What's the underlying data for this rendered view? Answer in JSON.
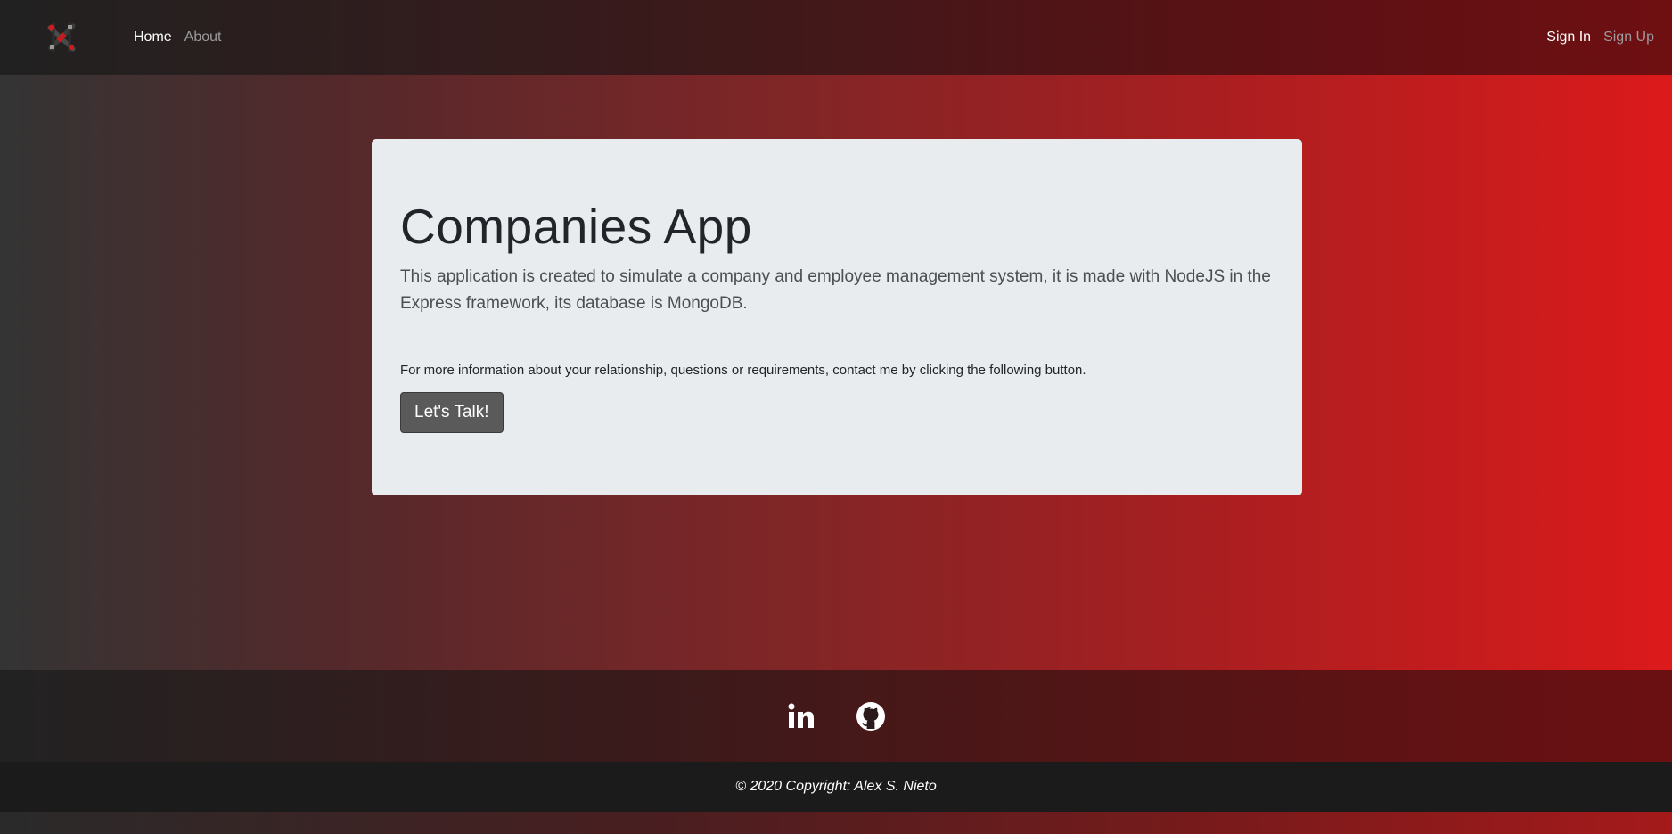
{
  "navbar": {
    "logo_icon": "tools-logo-icon",
    "links": [
      {
        "label": "Home",
        "active": true
      },
      {
        "label": "About",
        "active": false
      }
    ],
    "auth": [
      {
        "label": "Sign In",
        "active": true
      },
      {
        "label": "Sign Up",
        "active": false
      }
    ]
  },
  "jumbotron": {
    "title": "Companies App",
    "lead": "This application is created to simulate a company and employee management system, it is made with NodeJS in the Express framework, its database is MongoDB.",
    "text": "For more information about your relationship, questions or requirements, contact me by clicking the following button.",
    "button_label": "Let's Talk!"
  },
  "footer": {
    "icons": [
      "linkedin-icon",
      "github-icon"
    ],
    "copyright": "© 2020 Copyright: Alex S. Nieto"
  },
  "colors": {
    "gradient_start": "#343434",
    "gradient_end": "#dc1a1b",
    "jumbotron_bg": "#e9ecef",
    "button_bg": "#5a5a5a",
    "copyright_bg": "#1b1b1b"
  }
}
